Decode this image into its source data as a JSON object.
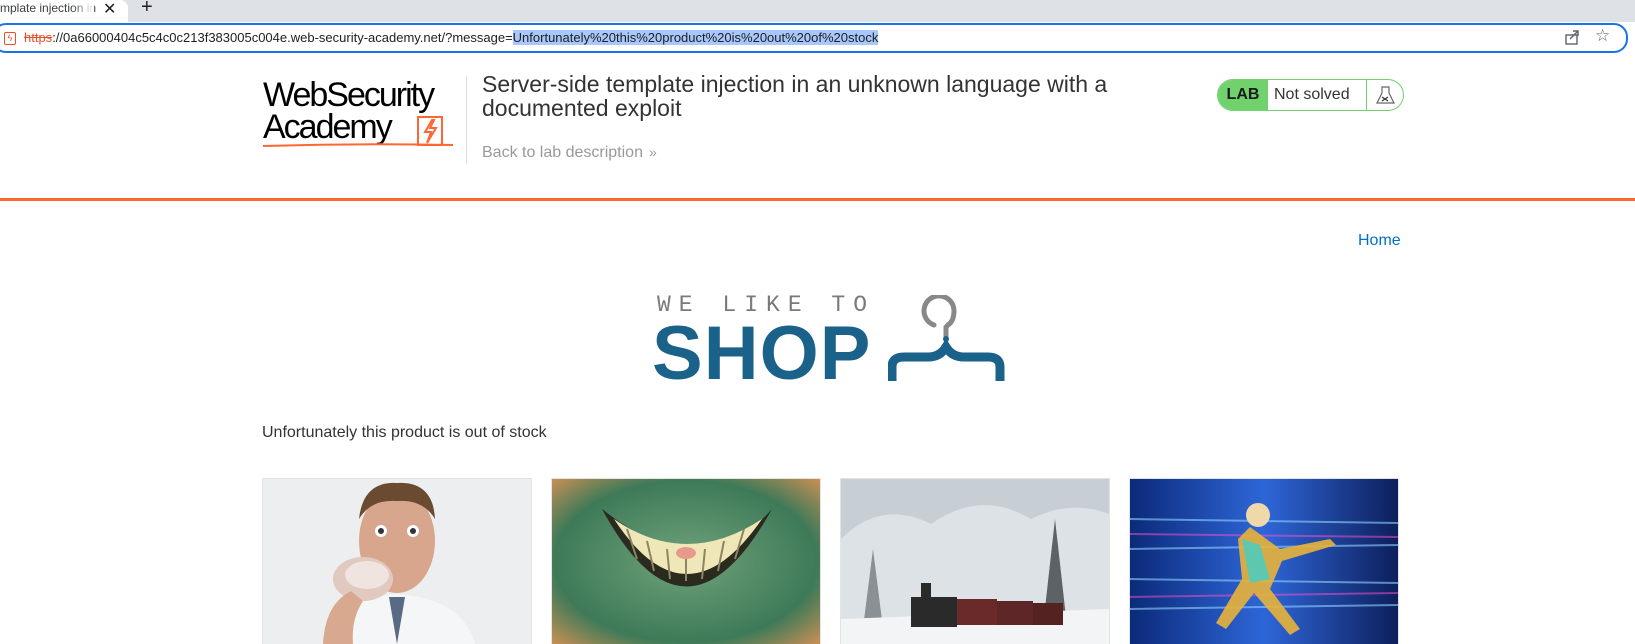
{
  "browser": {
    "tab_title": "mplate injection in",
    "url_scheme": "https",
    "url_host_path": "://0a66000404c5c4c0c213f383005c004e.web-security-academy.net/?message=",
    "url_selected": "Unfortunately%20this%20product%20is%20out%20of%20stock"
  },
  "header": {
    "logo_line1": "WebSecurity",
    "logo_line2": "Academy",
    "lab_title": "Server-side template injection in an unknown language with a documented exploit",
    "back_link": "Back to lab description",
    "lab_label": "LAB",
    "lab_status": "Not solved"
  },
  "nav": {
    "home": "Home"
  },
  "shop_logo": {
    "tagline": "WE LIKE TO",
    "word": "SHOP"
  },
  "message": "Unfortunately this product is out of stock",
  "products": [
    {
      "image": "man-eating-donut"
    },
    {
      "image": "cheshire-grin"
    },
    {
      "image": "snowy-train"
    },
    {
      "image": "speed-runner"
    }
  ],
  "colors": {
    "accent_orange": "#ff6633",
    "lab_green": "#70d16d",
    "shop_blue": "#1a6289",
    "link_blue": "#0070c9"
  }
}
